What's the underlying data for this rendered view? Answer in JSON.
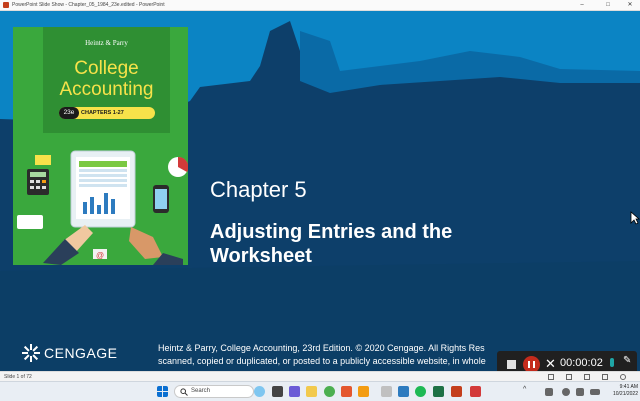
{
  "window": {
    "title": "PowerPoint Slide Show - Chapter_05_1984_23e.edited - PowerPoint",
    "minimize": "–",
    "maximize": "□",
    "close": "✕"
  },
  "slide": {
    "cover": {
      "authors": "Heintz & Parry",
      "title_line1": "College",
      "title_line2": "Accounting",
      "edition": "23e",
      "chapters": "CHAPTERS 1-27"
    },
    "chapter": "Chapter 5",
    "subtitle_line1": "Adjusting Entries and the",
    "subtitle_line2": "Worksheet",
    "brand": "CENGAGE",
    "copyright_line1": "Heintz & Parry, College Accounting, 23rd Edition. © 2020 Cengage. All Rights Res",
    "copyright_line2": "scanned, copied or duplicated, or posted to a publicly accessible website, in whole"
  },
  "recorder": {
    "elapsed": "00:00:02"
  },
  "statusbar": {
    "slide_indicator": "Slide 1 of 72"
  },
  "taskbar": {
    "search_label": "Search",
    "time": "9:41 AM",
    "date": "10/21/2022",
    "colors": {
      "background": "#e9eef4",
      "accent": "#0a6fd1"
    }
  },
  "colors": {
    "slide_bg": "#0d3f6a",
    "brush": "#0b84c4",
    "cover_green": "#3aa83d",
    "cover_title": "#f7e24a",
    "recorder_red": "#c42b1c"
  }
}
